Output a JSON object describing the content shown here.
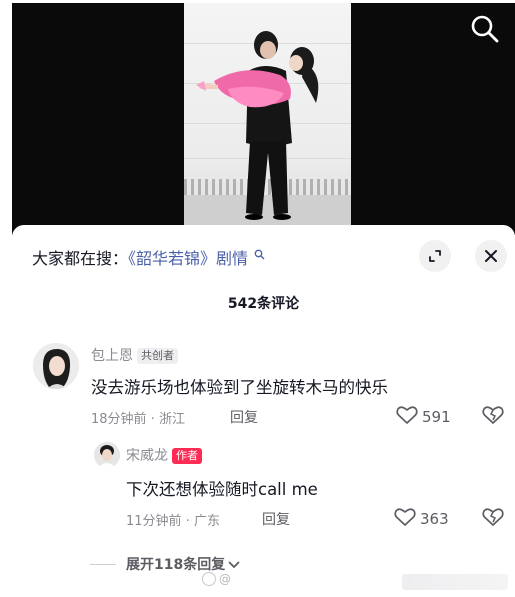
{
  "video": {
    "search_icon": "search-icon"
  },
  "header": {
    "hot_search_prefix": "大家都在搜：",
    "hot_search_keyword": "《韶华若锦》剧情",
    "expand_icon": "expand-icon",
    "close_icon": "close-icon"
  },
  "comment_count": "542条评论",
  "comments": [
    {
      "author": "包上恩",
      "tag": "共创者",
      "text": "没去游乐场也体验到了坐旋转木马的快乐",
      "time_location": "18分钟前 · 浙江",
      "reply_label": "回复",
      "likes": "591"
    }
  ],
  "reply": {
    "author": "宋威龙",
    "tag": "作者",
    "text": "下次还想体验随时call me",
    "time_location": "11分钟前 · 广东",
    "reply_label": "回复",
    "likes": "363"
  },
  "expand_replies": "展开118条回复",
  "watermark": "@",
  "colors": {
    "keyword": "#4a5fa8",
    "author_tag": "#fe2c55",
    "text": "#161823",
    "secondary": "#8a8b91"
  }
}
